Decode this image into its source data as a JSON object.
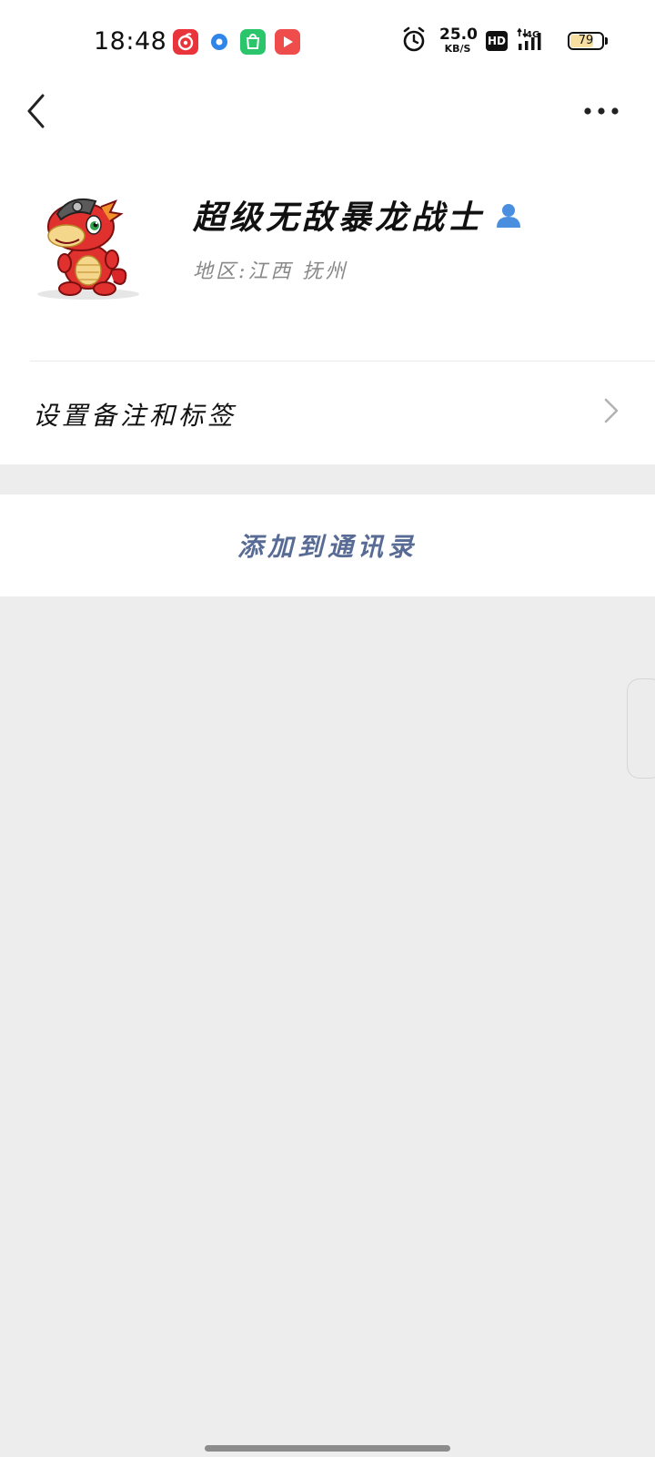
{
  "status_bar": {
    "time": "18:48",
    "net_speed_value": "25.0",
    "net_speed_unit": "KB/S",
    "hd_label": "HD",
    "network_label": "4G",
    "battery_percent": 79,
    "battery_text": "79",
    "app_icons": [
      "netease-music-icon",
      "browser-icon",
      "store-icon",
      "video-icon"
    ],
    "app_icon_colors": [
      "#e8343a",
      "#2f86e8",
      "#2bc56b",
      "#ef4c4c"
    ]
  },
  "profile": {
    "name": "超级无敌暴龙战士",
    "region": "地区:江西 抚州"
  },
  "menu": {
    "remark_label": "设置备注和标签",
    "add_contact_label": "添加到通讯录"
  },
  "colors": {
    "link_blue": "#576b95",
    "contact_icon": "#4a8ee0",
    "page_bg": "#ededed"
  }
}
